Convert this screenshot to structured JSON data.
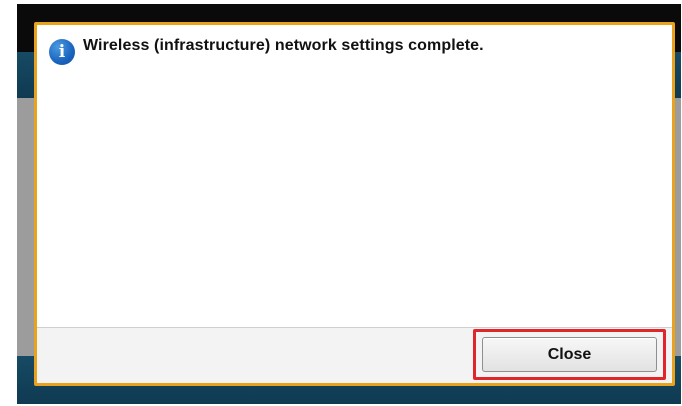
{
  "dialog": {
    "icon": "info-icon",
    "icon_glyph": "i",
    "message": "Wireless (infrastructure) network settings complete.",
    "close_label": "Close"
  },
  "colors": {
    "dialog_border": "#e8a21d",
    "highlight_border": "#e0262a",
    "info_icon": "#1a64bf"
  }
}
